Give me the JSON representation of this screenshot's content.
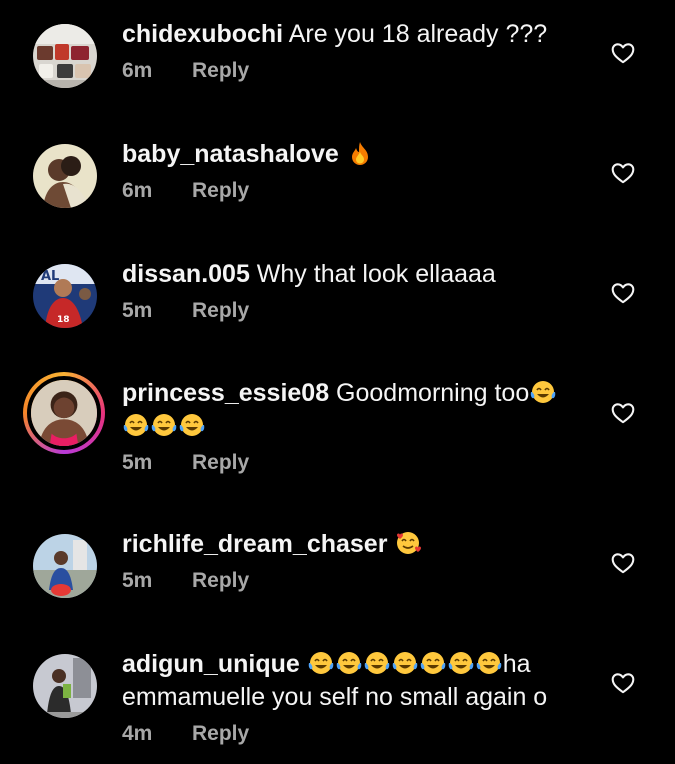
{
  "comments": [
    {
      "username": "chidexubochi",
      "text": " Are you 18 already ???",
      "emojis_after": [],
      "line2": "",
      "time": "6m",
      "reply_label": "Reply",
      "avatar": "handbags-photo",
      "has_story_ring": false
    },
    {
      "username": "baby_natashalove",
      "text": " ",
      "emojis_after": [
        "fire-emoji"
      ],
      "line2": "",
      "time": "6m",
      "reply_label": "Reply",
      "avatar": "couple-photo",
      "has_story_ring": false
    },
    {
      "username": "dissan.005",
      "text": " Why that look ellaaaa",
      "emojis_after": [],
      "line2": "",
      "time": "5m",
      "reply_label": "Reply",
      "avatar": "jersey-18-photo",
      "has_story_ring": false
    },
    {
      "username": "princess_essie08",
      "text": " Goodmorning too",
      "emojis_after": [
        "tears-of-joy-emoji"
      ],
      "line2_emojis": [
        "tears-of-joy-emoji",
        "tears-of-joy-emoji",
        "tears-of-joy-emoji"
      ],
      "line2": "",
      "time": "5m",
      "reply_label": "Reply",
      "avatar": "woman-photo",
      "has_story_ring": true
    },
    {
      "username": "richlife_dream_chaser",
      "text": " ",
      "emojis_after": [
        "smiling-face-with-hearts-emoji"
      ],
      "line2": "",
      "time": "5m",
      "reply_label": "Reply",
      "avatar": "man-outdoor-photo",
      "has_story_ring": false
    },
    {
      "username": "adigun_unique",
      "text": " ",
      "emojis_after": [
        "tears-of-joy-emoji",
        "tears-of-joy-emoji",
        "tears-of-joy-emoji",
        "tears-of-joy-emoji",
        "tears-of-joy-emoji",
        "tears-of-joy-emoji",
        "tears-of-joy-emoji"
      ],
      "text_after_emojis": "ha",
      "line2": "emmamuelle you self no small again o",
      "time": "4m",
      "reply_label": "Reply",
      "avatar": "man-street-photo",
      "has_story_ring": false
    }
  ],
  "colors": {
    "background": "#000000",
    "text_primary": "#f5f5f5",
    "text_secondary": "#a8a8a8",
    "story_ring": "#e8327c"
  },
  "icons": {
    "like": "heart-outline-icon"
  }
}
